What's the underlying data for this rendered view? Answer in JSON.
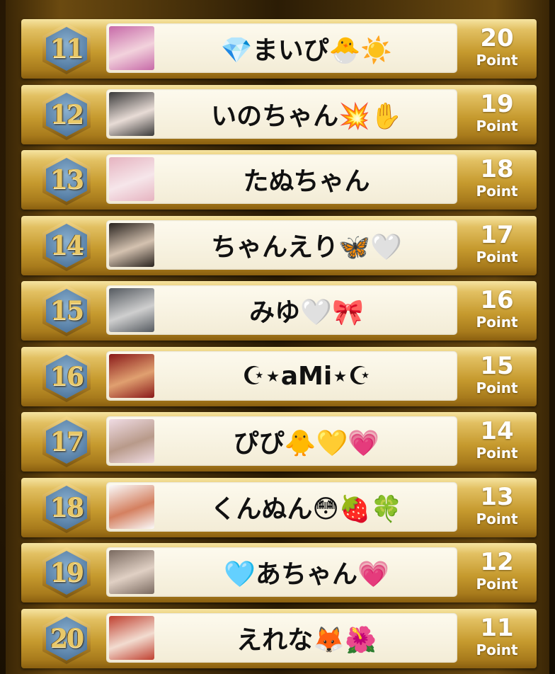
{
  "ranking": [
    {
      "rank": "11",
      "name": "💎まいぴ🐣☀️",
      "points": "20",
      "unit": "Point",
      "avatar_colors": [
        "#c76aa8",
        "#f2d2dc"
      ]
    },
    {
      "rank": "12",
      "name": "いのちゃん💥✋",
      "points": "19",
      "unit": "Point",
      "avatar_colors": [
        "#3a3a3a",
        "#e8dcd6"
      ]
    },
    {
      "rank": "13",
      "name": "たぬちゃん",
      "points": "18",
      "unit": "Point",
      "avatar_colors": [
        "#e6b3c0",
        "#f6e6ea"
      ]
    },
    {
      "rank": "14",
      "name": "ちゃんえり🦋🤍",
      "points": "17",
      "unit": "Point",
      "avatar_colors": [
        "#2a2420",
        "#d4c2b0"
      ]
    },
    {
      "rank": "15",
      "name": "みゆ🤍🎀",
      "points": "16",
      "unit": "Point",
      "avatar_colors": [
        "#555a60",
        "#cfcfcf"
      ]
    },
    {
      "rank": "16",
      "name": "☪︎⋆aMi⋆☪︎",
      "points": "15",
      "unit": "Point",
      "avatar_colors": [
        "#8a1a1a",
        "#e0a070"
      ]
    },
    {
      "rank": "17",
      "name": "ぴぴ🐥💛💗",
      "points": "14",
      "unit": "Point",
      "avatar_colors": [
        "#f0dce4",
        "#b89a8a"
      ]
    },
    {
      "rank": "18",
      "name": "くんぬん😳🍓🍀",
      "points": "13",
      "unit": "Point",
      "avatar_colors": [
        "#fafafa",
        "#d48060"
      ]
    },
    {
      "rank": "19",
      "name": "🩵あちゃん💗",
      "points": "12",
      "unit": "Point",
      "avatar_colors": [
        "#7a6a60",
        "#e0d0c4"
      ]
    },
    {
      "rank": "20",
      "name": "えれな🦊🌺",
      "points": "11",
      "unit": "Point",
      "avatar_colors": [
        "#c04030",
        "#f2dcd0"
      ]
    }
  ],
  "theme": {
    "gold": "#c69a2e",
    "badge_blue": "#5d85ab",
    "card": "#f8f2de"
  }
}
